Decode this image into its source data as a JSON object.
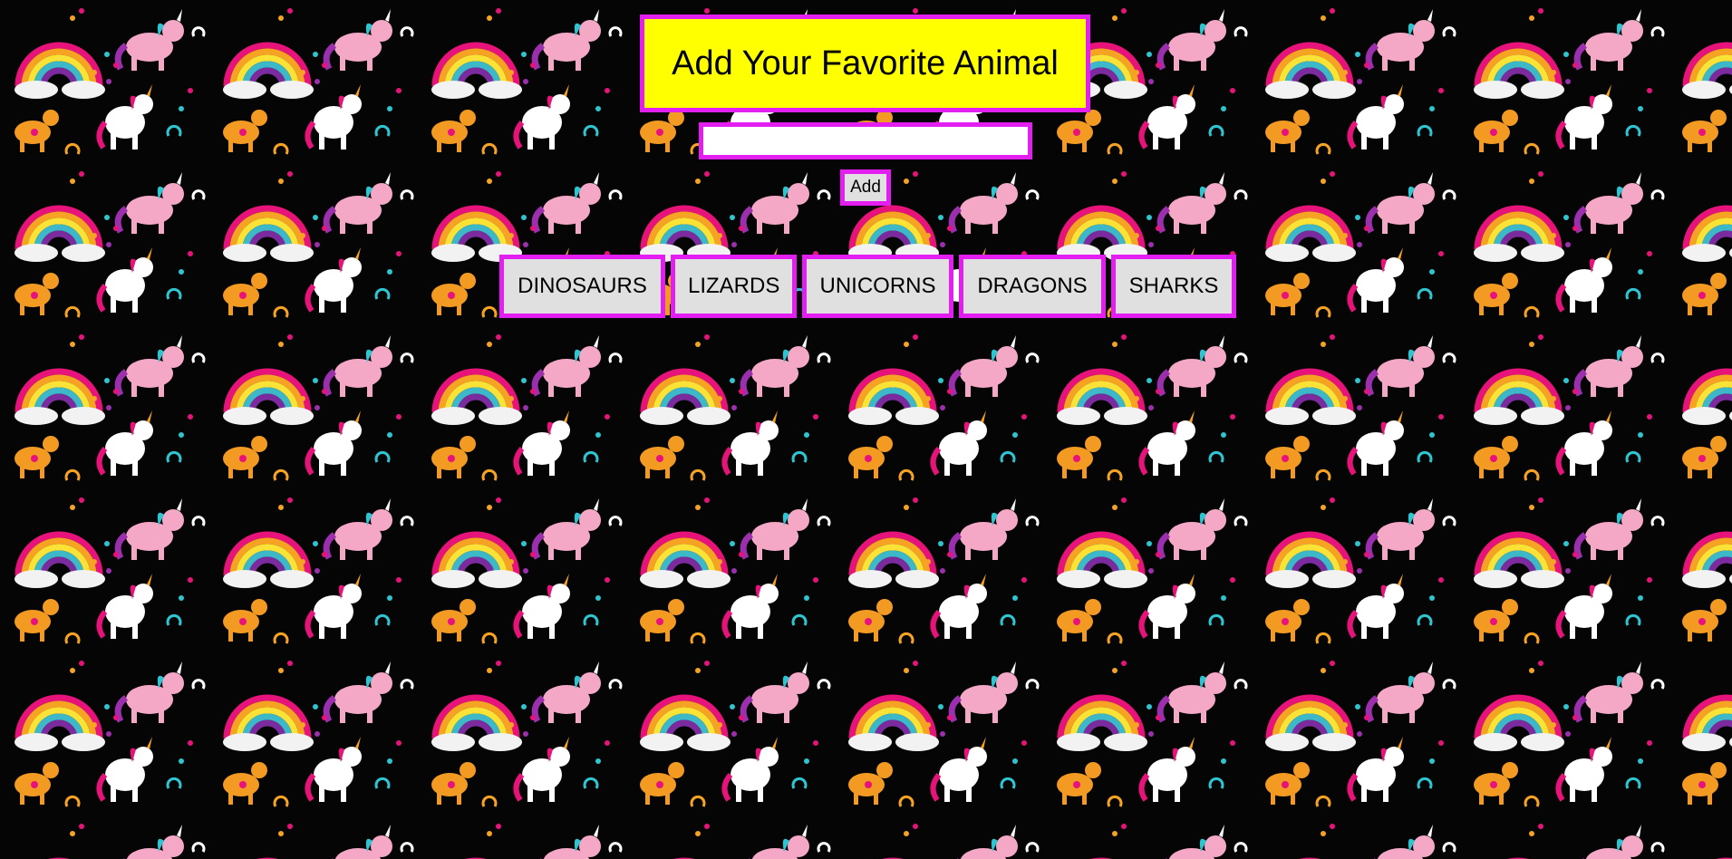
{
  "page": {
    "title": "Add Your Favorite Animal"
  },
  "form": {
    "input_value": "",
    "input_placeholder": "",
    "add_label": "Add"
  },
  "animals": [
    {
      "label": "DINOSAURS"
    },
    {
      "label": "LIZARDS"
    },
    {
      "label": "UNICORNS"
    },
    {
      "label": "DRAGONS"
    },
    {
      "label": "SHARKS"
    }
  ],
  "colors": {
    "accent_border": "#e21ff0",
    "title_background": "#ffff00",
    "button_background": "#e0e0e0",
    "page_background": "#050505"
  },
  "background": {
    "image": "unicorn-rainbow-pattern"
  }
}
